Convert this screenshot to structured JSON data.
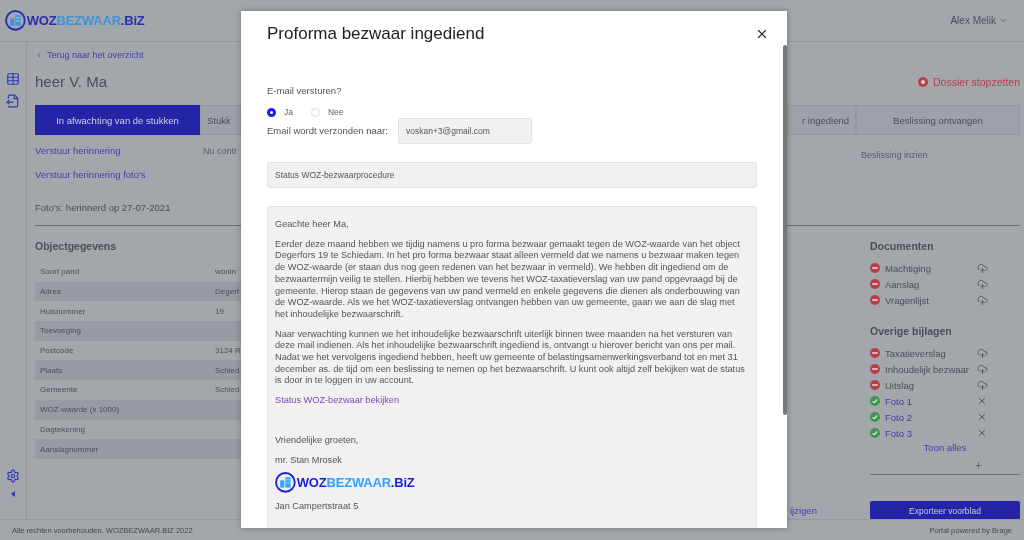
{
  "header": {
    "logo": [
      "WOZ",
      "BEZWAAR",
      ".BiZ"
    ],
    "user": "Alex Melik"
  },
  "back_link": "Terug naar het overzicht",
  "title": "heer V. Ma",
  "stop_action": "Dossier stopzetten",
  "tabs": [
    {
      "label": "In afwachting van de stukken",
      "selected": true
    },
    {
      "label": "Stukk",
      "selected": false
    },
    {
      "label": "r ingediend",
      "selected": false
    },
    {
      "label": "Beslissing ontvangen",
      "selected": false
    }
  ],
  "actions": [
    "Verstuur herinnering",
    "Verstuur herinnering foto's"
  ],
  "pending_note": "Nu contr",
  "decision_note": "Beslissing inzien",
  "photo_note": "Foto's: herinnerd op 27-07-2021",
  "object_section": {
    "title": "Objectgegevens",
    "rows": [
      {
        "label": "Soort pand",
        "value": "wonin"
      },
      {
        "label": "Adres",
        "value": "Degerf"
      },
      {
        "label": "Huisnummer",
        "value": "19"
      },
      {
        "label": "Toevoeging"
      },
      {
        "label": "Postcode",
        "value": "3124 R"
      },
      {
        "label": "Plaats",
        "value": "Schied"
      },
      {
        "label": "Gemeente",
        "value": "Schied"
      },
      {
        "label": "WOZ-waarde (x 1000)"
      },
      {
        "label": "Dagtekening"
      },
      {
        "label": "Aanslagnummer"
      }
    ]
  },
  "documents": {
    "title": "Documenten",
    "items": [
      {
        "label": "Machtiging",
        "kind": "missing"
      },
      {
        "label": "Aanslag",
        "kind": "missing"
      },
      {
        "label": "Vragenlijst",
        "kind": "missing"
      }
    ]
  },
  "attachments": {
    "title": "Overige bijlagen",
    "items": [
      {
        "label": "Taxatieverslag",
        "kind": "missing"
      },
      {
        "label": "Inhoudelijk bezwaar",
        "kind": "missing"
      },
      {
        "label": "Uitslag",
        "kind": "missing"
      },
      {
        "label": "Foto 1",
        "kind": "uploaded"
      },
      {
        "label": "Foto 2",
        "kind": "uploaded"
      },
      {
        "label": "Foto 3",
        "kind": "uploaded"
      }
    ],
    "show_all": "Toon alles"
  },
  "edit_link": "ijzigen",
  "export_button": "Exporteer voorblad",
  "footer": {
    "copyright": "Alle rechten voorbehouden. WOZBEZWAAR.BIZ 2022",
    "powered": "Portal powered by Brage"
  },
  "modal": {
    "title": "Proforma bezwaar ingediend",
    "send_label": "E-mail versturen?",
    "send_options": [
      {
        "label": "Ja",
        "selected": true
      },
      {
        "label": "Nee",
        "selected": false
      }
    ],
    "recipient_label": "Email wordt verzonden naar:",
    "recipient": "voskan+3@gmail.com",
    "subject": "Status WOZ-bezwaarprocedure",
    "letter": {
      "greeting": "Geachte heer Ma,",
      "paragraphs": [
        "Eerder deze maand hebben we tijdig namens u pro forma bezwaar gemaakt tegen de WOZ-waarde van het object Degerfors 19 te Schiedam. In het pro forma bezwaar staat alleen vermeld dat we namens u bezwaar maken tegen de WOZ-waarde (er staan dus nog geen redenen van het bezwaar in vermeld). We hebben dit ingediend om de bezwaartermijn veilig te stellen. Hierbij hebben we tevens het WOZ-taxatieverslag van uw pand opgevraagd bij de gemeente. Hierop staan de gegevens van uw pand vermeld en enkele gegevens die dienen als onderbouwing van de WOZ-waarde. Als we het WOZ-taxatieverslag ontvangen hebben van uw gemeente, gaan we aan de slag met het inhoudelijke bezwaarschrift.",
        "Naar verwachting kunnen we het inhoudelijke bezwaarschrift uiterlijk binnen twee maanden na het versturen van deze mail indienen. Als het inhoudelijke bezwaarschrift ingediend is, ontvangt u hierover bericht van ons per mail. Nadat we het vervolgens ingediend hebben, heeft uw gemeente of belastingsamenwerkingsverband tot en met 31 december as. de tijd om een beslissing te nemen op het bezwaarschrift. U kunt ook altijd zelf bekijken wat de status is door in te loggen in uw account."
      ],
      "link": "Status WOZ-bezwaar bekijken",
      "closing": "Vriendelijke groeten,",
      "signer": "mr. Stan Mrosek",
      "logo": [
        "WOZ",
        "BEZWAAR",
        ".BiZ"
      ],
      "address": [
        "Jan Campertstraat 5"
      ]
    }
  }
}
